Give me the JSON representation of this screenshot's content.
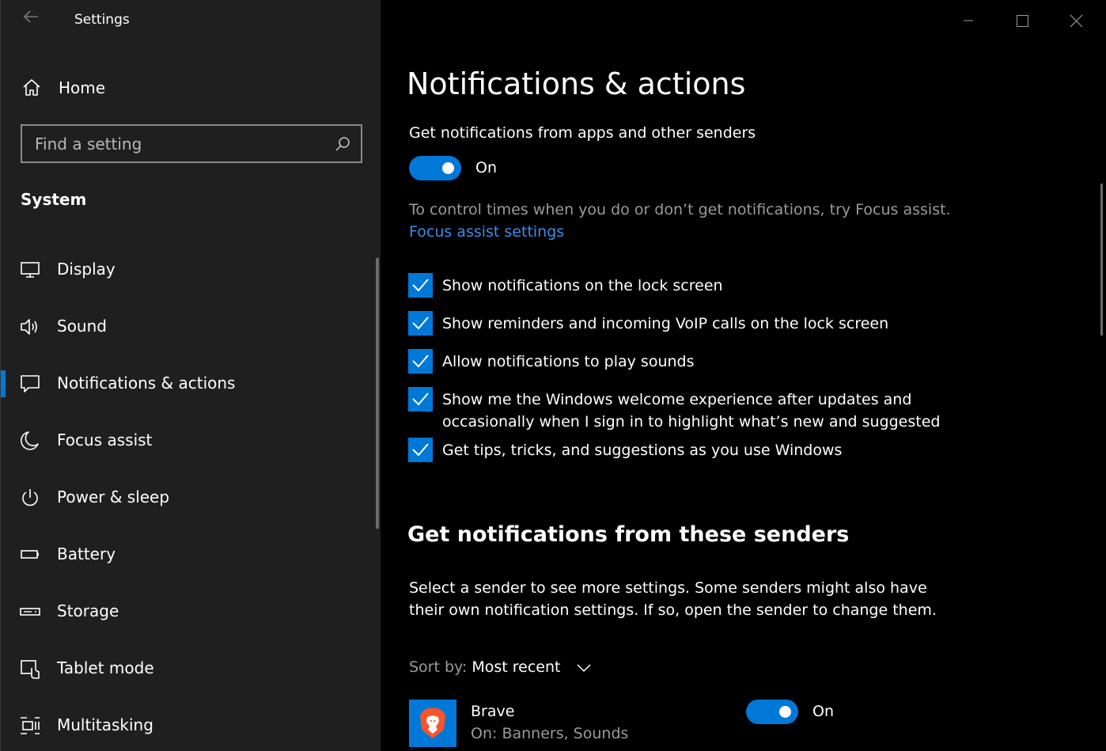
{
  "window": {
    "title": "Settings",
    "back_icon": "back-arrow-icon",
    "controls": [
      "minimize-icon",
      "maximize-icon",
      "close-icon"
    ]
  },
  "sidebar": {
    "home_label": "Home",
    "search_placeholder": "Find a setting",
    "section_title": "System",
    "items": [
      {
        "label": "Display",
        "icon": "monitor-icon"
      },
      {
        "label": "Sound",
        "icon": "speaker-icon"
      },
      {
        "label": "Notifications & actions",
        "icon": "message-icon",
        "selected": true
      },
      {
        "label": "Focus assist",
        "icon": "moon-icon"
      },
      {
        "label": "Power & sleep",
        "icon": "power-icon"
      },
      {
        "label": "Battery",
        "icon": "battery-icon"
      },
      {
        "label": "Storage",
        "icon": "drive-icon"
      },
      {
        "label": "Tablet mode",
        "icon": "tablet-mode-icon"
      },
      {
        "label": "Multitasking",
        "icon": "multitasking-icon"
      }
    ]
  },
  "main": {
    "title": "Notifications & actions",
    "get_notifications_label": "Get notifications from apps and other senders",
    "get_notifications_toggle": "On",
    "focus_hint": "To control times when you do or don’t get notifications, try Focus assist.",
    "focus_link": "Focus assist settings",
    "checkboxes": [
      {
        "line1": "Show notifications on the lock screen",
        "line2": "",
        "checked": true
      },
      {
        "line1": "Show reminders and incoming VoIP calls on the lock screen",
        "line2": "",
        "checked": true
      },
      {
        "line1": "Allow notifications to play sounds",
        "line2": "",
        "checked": true
      },
      {
        "line1": "Show me the Windows welcome experience after updates and",
        "line2": "occasionally when I sign in to highlight what’s new and suggested",
        "checked": true
      },
      {
        "line1": "Get tips, tricks, and suggestions as you use Windows",
        "line2": "",
        "checked": true
      }
    ],
    "senders_heading": "Get notifications from these senders",
    "senders_desc_line1": "Select a sender to see more settings. Some senders might also have",
    "senders_desc_line2": "their own notification settings. If so, open the sender to change them.",
    "sort_label": "Sort by:",
    "sort_value": "Most recent",
    "apps": [
      {
        "name": "Brave",
        "status": "On: Banners, Sounds",
        "toggle": "On",
        "icon": "brave-lion-icon"
      }
    ]
  },
  "colors": {
    "accent": "#0078d7",
    "sidebar_bg": "#1f1f1f",
    "main_bg": "#000000",
    "link": "#3b8ee6",
    "muted_text": "#9a9a9a"
  }
}
